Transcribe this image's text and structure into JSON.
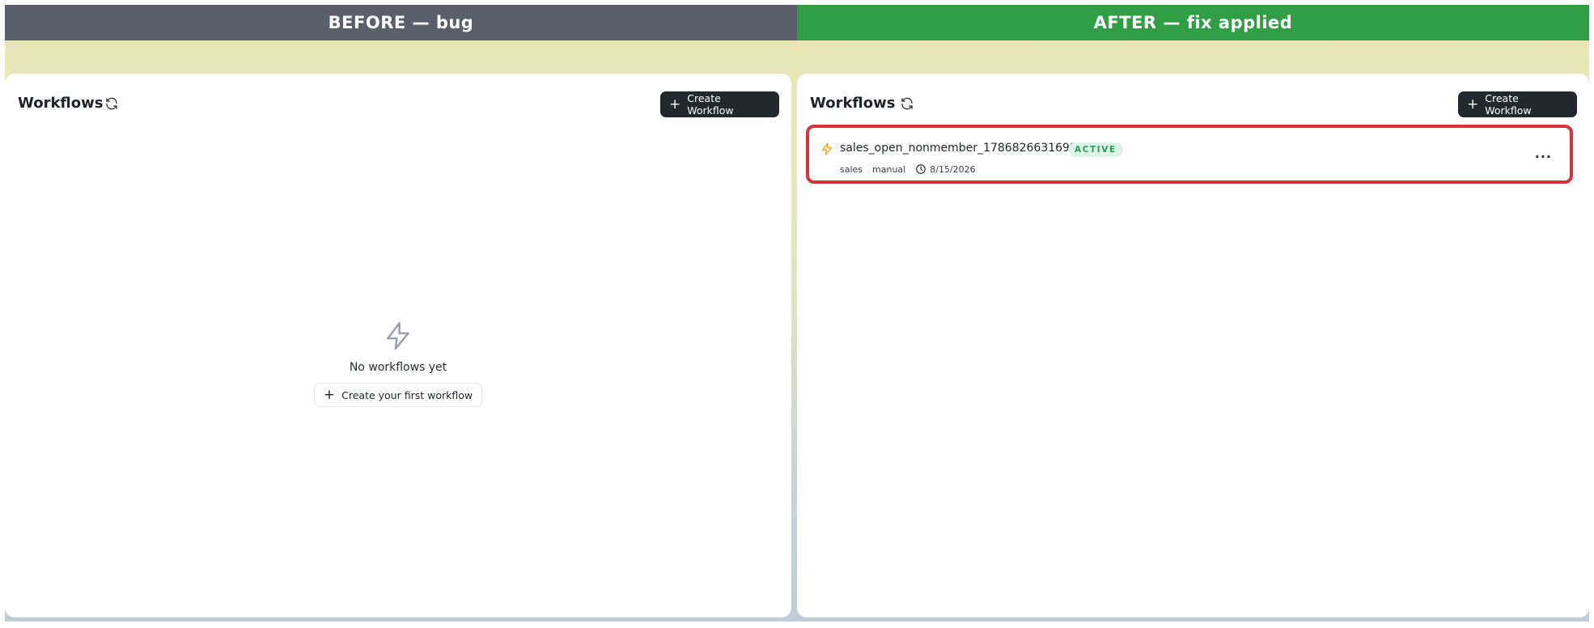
{
  "before": {
    "header": "BEFORE — bug",
    "title": "Workflows",
    "create_label": "Create Workflow",
    "empty_text": "No workflows yet",
    "first_button_label": "Create your first workflow"
  },
  "after": {
    "header": "AFTER — fix applied",
    "title": "Workflows",
    "create_label": "Create Workflow",
    "workflows": [
      {
        "name": "sales_open_nonmember_1786826631692",
        "status": "ACTIVE",
        "tag": "sales",
        "trigger": "manual",
        "date": "8/15/2026",
        "more": "..."
      }
    ]
  },
  "icons": {
    "refresh": "refresh-icon",
    "plus": "plus-icon",
    "bolt": "lightning-bolt-icon",
    "clock": "clock-icon",
    "more": "more-horizontal-icon"
  },
  "colors": {
    "before_header": "#5b5f6a",
    "after_header": "#2f9e44",
    "highlight_border": "#d8323a",
    "button_bg": "#23272e",
    "status_bg": "#dcf5e6",
    "status_text": "#2c9a5b",
    "bolt_active": "#f5a623",
    "bolt_empty": "#9ca0a8"
  }
}
